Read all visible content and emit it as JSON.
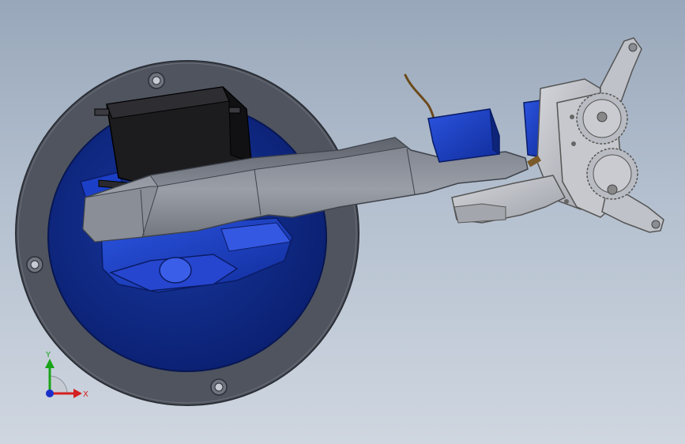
{
  "viewport": {
    "background_top": "#98a7ba",
    "background_bottom": "#cfd6e0"
  },
  "colors": {
    "base_ring": "#555a66",
    "base_disc": "#0f2a8c",
    "arm_gray": "#8f939c",
    "servo_blue": "#1a3fc4",
    "servo_black": "#1c1c1f",
    "gripper_gray": "#b9bcc2",
    "wire_brown": "#6b4a1c"
  },
  "parts": [
    {
      "name": "base-plate",
      "icon": "circular-plate-icon"
    },
    {
      "name": "base-disc",
      "icon": "disc-icon"
    },
    {
      "name": "shoulder-servo",
      "icon": "servo-icon"
    },
    {
      "name": "upper-arm-link",
      "icon": "link-icon"
    },
    {
      "name": "lower-servo-housing",
      "icon": "servo-housing-icon"
    },
    {
      "name": "wrist-servo",
      "icon": "servo-icon"
    },
    {
      "name": "wrist-wire",
      "icon": "wire-icon"
    },
    {
      "name": "gripper-gear-assembly",
      "icon": "gear-icon"
    },
    {
      "name": "gripper-finger-top",
      "icon": "finger-icon"
    },
    {
      "name": "gripper-finger-bottom",
      "icon": "finger-icon"
    }
  ],
  "triad": {
    "x_label": "X",
    "y_label": "Y",
    "x_color": "#d42020",
    "y_color": "#1aa31a",
    "z_color": "#1a2fc9"
  }
}
